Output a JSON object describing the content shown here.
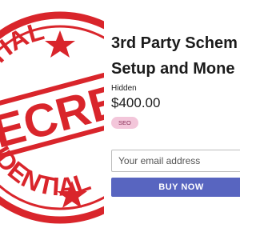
{
  "product": {
    "image_label_top": "DENTIAL",
    "image_label_main": "SECRET",
    "image_label_bottom": "FIDENTIAL",
    "title_line1": "3rd Party Schem",
    "title_line2": "Setup and Mone",
    "sku": "Hidden",
    "price": "$400.00",
    "tag": "SEO"
  },
  "purchase": {
    "email_placeholder": "Your email address",
    "buy_label": "BUY NOW"
  },
  "colors": {
    "stamp_red": "#d9252b",
    "button": "#5865c0",
    "tag_bg": "#f3c6da"
  }
}
